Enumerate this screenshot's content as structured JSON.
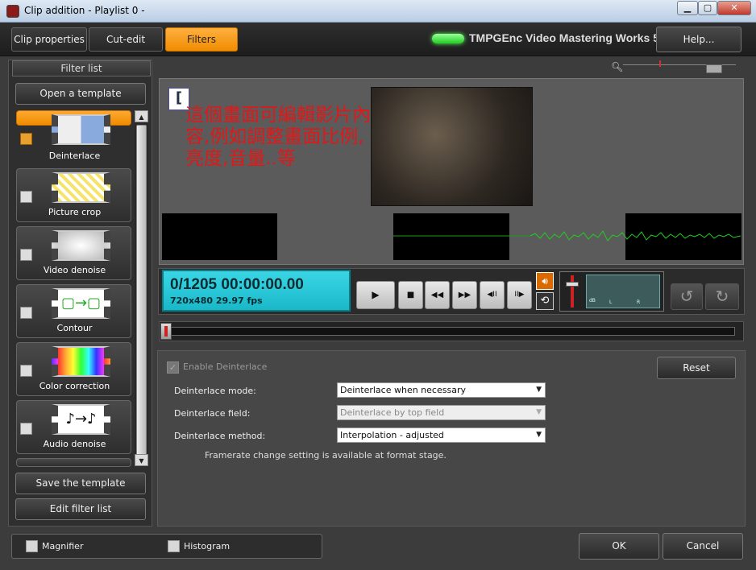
{
  "window": {
    "title": "Clip addition - Playlist 0 -",
    "min": "▁",
    "max": "▢",
    "close": "✕"
  },
  "tabs": [
    {
      "label": "Clip properties",
      "active": false
    },
    {
      "label": "Cut-edit",
      "active": false
    },
    {
      "label": "Filters",
      "active": true
    }
  ],
  "brand": "TMPGEnc Video Mastering Works 5",
  "help_label": "Help...",
  "filter_panel": {
    "title": "Filter list",
    "open_template": "Open a template",
    "save_template": "Save the template",
    "edit_list": "Edit filter list",
    "items": [
      {
        "label": "Deinterlace",
        "checked": true,
        "selected": true
      },
      {
        "label": "Picture crop",
        "checked": false,
        "selected": false
      },
      {
        "label": "Video denoise",
        "checked": false,
        "selected": false
      },
      {
        "label": "Contour",
        "checked": false,
        "selected": false
      },
      {
        "label": "Color correction",
        "checked": false,
        "selected": false
      },
      {
        "label": "Audio denoise",
        "checked": false,
        "selected": false
      }
    ]
  },
  "preview": {
    "annotation": "這個畫面可編輯影片內容,例如調整畫面比例,亮度,音量..等"
  },
  "transport": {
    "frame_time": "0/1205  00:00:00.00",
    "format": "720x480 29.97  fps",
    "play": "▶",
    "stop": "■",
    "rewind": "◀◀",
    "forward": "▶▶",
    "prev_frame": "◀II",
    "next_frame": "II▶",
    "meter_labels": {
      "left": "L",
      "right": "R",
      "db": "dB"
    }
  },
  "settings": {
    "enable_label": "Enable Deinterlace",
    "enable_checked": true,
    "reset": "Reset",
    "mode_label": "Deinterlace mode:",
    "mode_value": "Deinterlace when necessary",
    "field_label": "Deinterlace field:",
    "field_value": "Deinterlace by top field",
    "method_label": "Deinterlace method:",
    "method_value": "Interpolation - adjusted",
    "note": "Framerate change setting is available at format stage."
  },
  "bottom": {
    "magnifier": "Magnifier",
    "histogram": "Histogram",
    "ok": "OK",
    "cancel": "Cancel"
  },
  "colors": {
    "accent": "#f39200",
    "lcd": "#22c4d4",
    "annotation": "#e01818",
    "waveform": "#22cc22"
  }
}
